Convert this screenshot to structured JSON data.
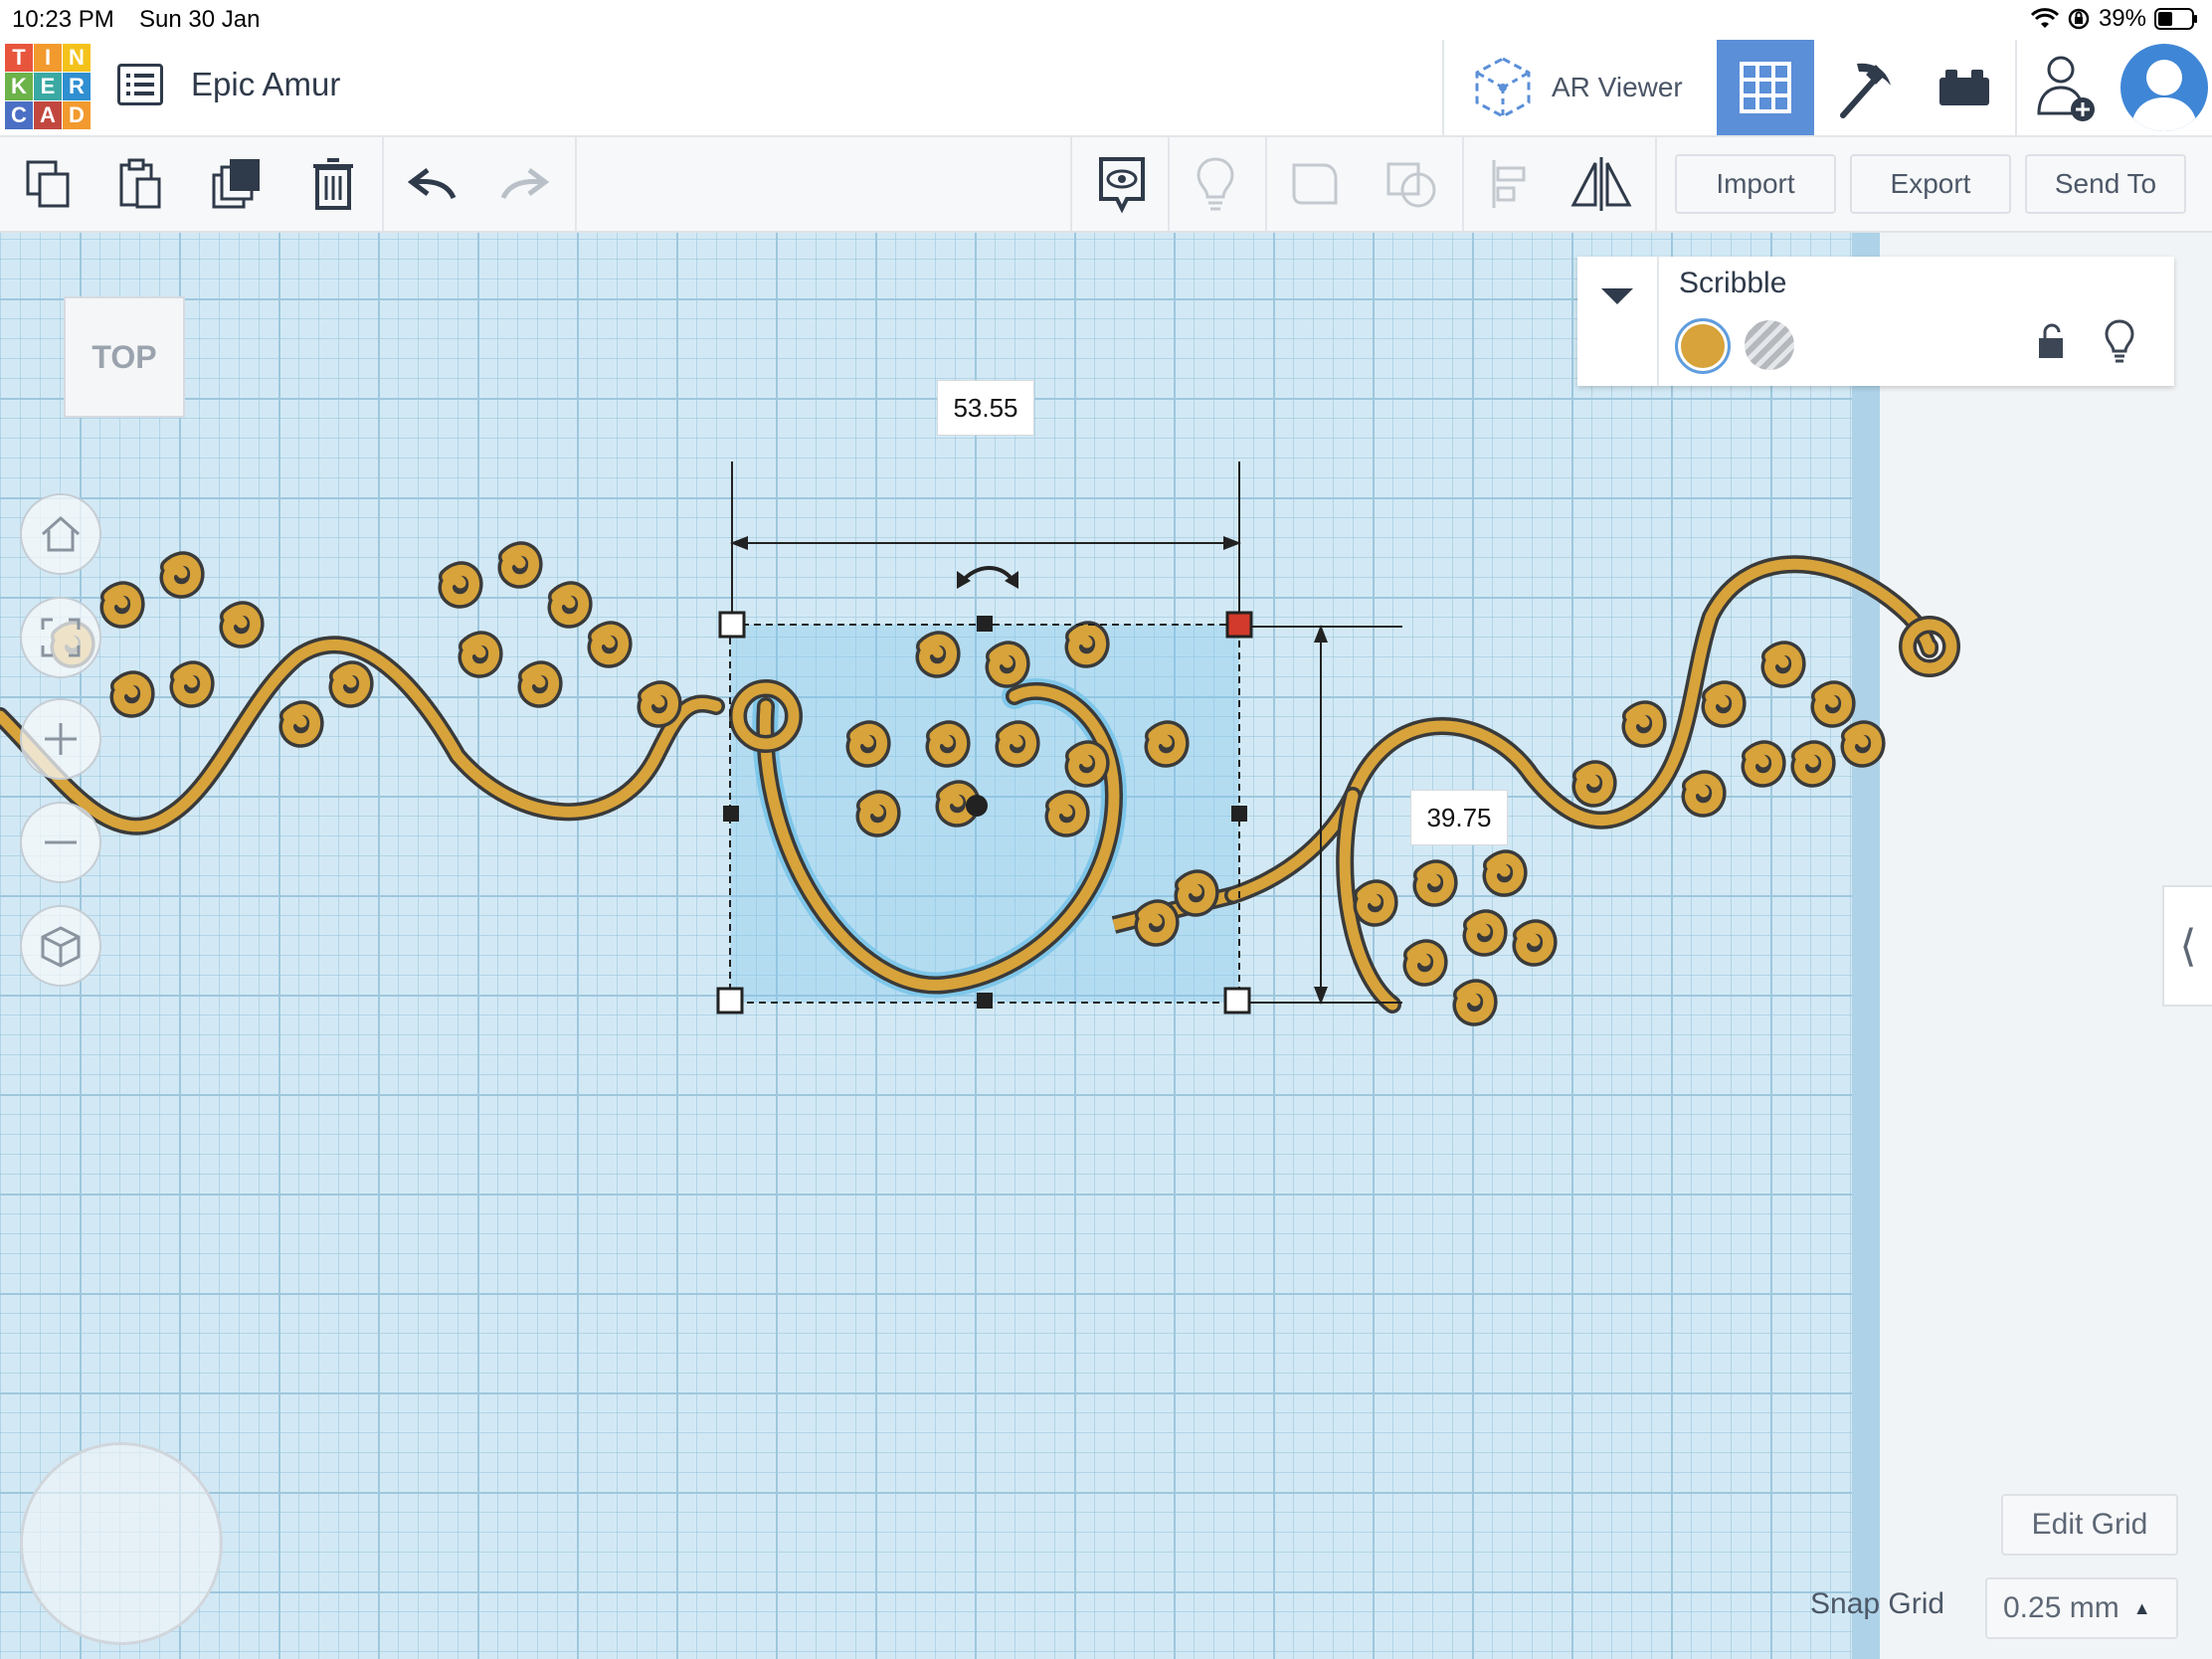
{
  "status_bar": {
    "time": "10:23 PM",
    "date": "Sun 30 Jan",
    "battery": "39%",
    "icons": [
      "wifi-icon",
      "rotation-lock-icon",
      "battery-icon"
    ]
  },
  "header": {
    "logo_letters": [
      "T",
      "I",
      "N",
      "K",
      "E",
      "R",
      "C",
      "A",
      "D"
    ],
    "logo_colors": [
      "#e8553d",
      "#f29a2e",
      "#f4c21b",
      "#6cb34a",
      "#3aa9a3",
      "#2f8fd1",
      "#4a6fc4",
      "#c2483f",
      "#f29a2e"
    ],
    "design_title": "Epic Amur",
    "ar_viewer_label": "AR Viewer",
    "views": [
      {
        "name": "3D Design",
        "icon": "grid-icon",
        "active": true
      },
      {
        "name": "Codeblocks",
        "icon": "pickaxe-icon",
        "active": false
      },
      {
        "name": "Bricks",
        "icon": "brick-icon",
        "active": false
      }
    ],
    "accent": "#5b8fd8"
  },
  "toolbar": {
    "left_tools": [
      "copy-icon",
      "paste-icon",
      "duplicate-icon",
      "delete-icon",
      "undo-icon",
      "redo-icon"
    ],
    "right_tools": [
      "note-visibility-icon",
      "lightbulb-icon",
      "group-icon",
      "ungroup-icon",
      "align-icon",
      "mirror-icon"
    ],
    "import_label": "Import",
    "export_label": "Export",
    "send_to_label": "Send To"
  },
  "viewport": {
    "view_cube_label": "TOP",
    "controls": [
      "home-icon",
      "fit-view-icon",
      "zoom-in-icon",
      "zoom-out-icon",
      "perspective-icon"
    ],
    "width_dimension": "53.55",
    "height_dimension": "39.75",
    "shape_color": "#d7a33a",
    "selection_color": "#7fc7ea"
  },
  "inspector": {
    "shape_name": "Scribble",
    "solid_color": "#d7a33a",
    "hole_label": "Hole"
  },
  "bottom_right": {
    "edit_grid_label": "Edit Grid",
    "snap_grid_label": "Snap Grid",
    "snap_grid_value": "0.25 mm"
  }
}
